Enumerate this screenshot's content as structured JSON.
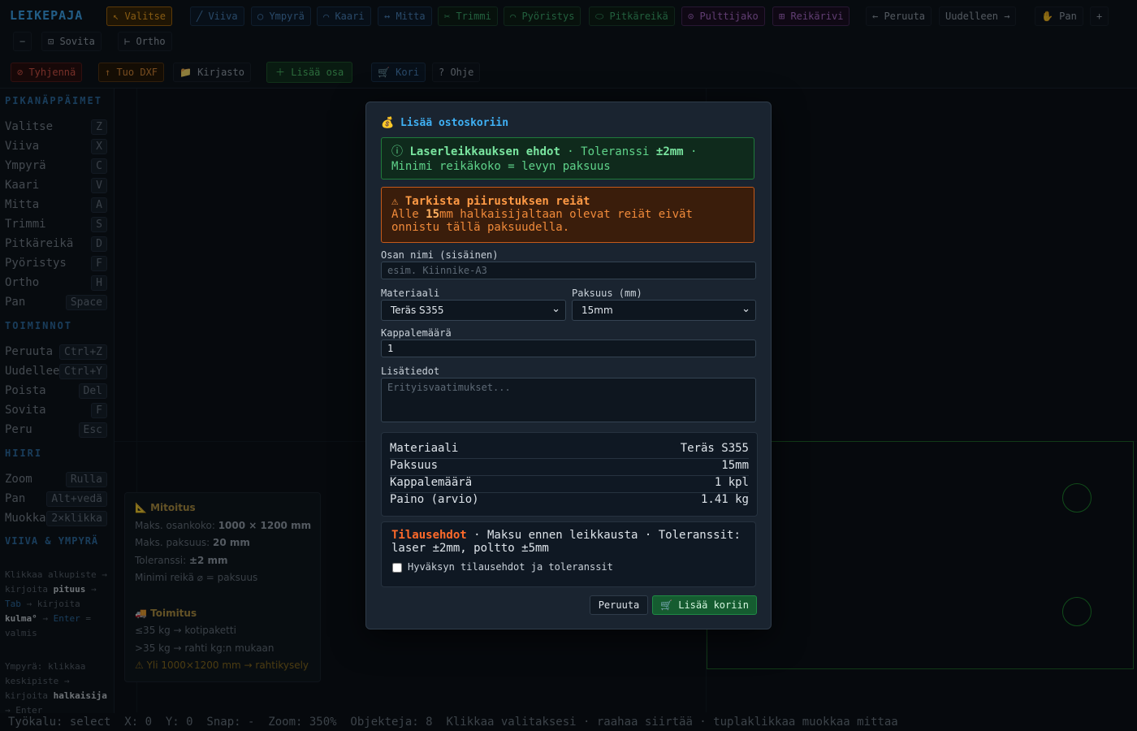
{
  "app": {
    "logo": "LEIKEPAJA"
  },
  "toolbar": {
    "tools": [
      {
        "label": "↖ Valitse"
      },
      {
        "label": "╱ Viiva"
      },
      {
        "label": "○ Ympyrä"
      },
      {
        "label": "⌒ Kaari"
      },
      {
        "label": "↔ Mitta"
      },
      {
        "label": "✂ Trimmi"
      },
      {
        "label": "⌒ Pyöristys"
      },
      {
        "label": "⬭ Pitkäreikä"
      },
      {
        "label": "⊙ Pulttijako"
      },
      {
        "label": "⊞ Reikärivi"
      }
    ],
    "undo": "← Peruuta",
    "redo": "Uudelleen →",
    "pan": "✋ Pan",
    "zoom_in": "+",
    "zoom_out": "−",
    "fit": "⊡ Sovita",
    "ortho": "⊢ Ortho",
    "clear": "⊘ Tyhjennä",
    "import": "↑ Tuo DXF",
    "library": "📁 Kirjasto",
    "add_part": "＋ Lisää osa",
    "cart": "🛒 Kori",
    "help": "? Ohje"
  },
  "sidebar": {
    "shortcuts_title": "PIKANÄPPÄIMET",
    "shortcuts": [
      {
        "name": "Valitse",
        "key": "Z"
      },
      {
        "name": "Viiva",
        "key": "X"
      },
      {
        "name": "Ympyrä",
        "key": "C"
      },
      {
        "name": "Kaari",
        "key": "V"
      },
      {
        "name": "Mitta",
        "key": "A"
      },
      {
        "name": "Trimmi",
        "key": "S"
      },
      {
        "name": "Pitkäreikä",
        "key": "D"
      },
      {
        "name": "Pyöristys",
        "key": "F"
      },
      {
        "name": "Ortho",
        "key": "H"
      },
      {
        "name": "Pan",
        "key": "Space"
      }
    ],
    "actions_title": "TOIMINNOT",
    "actions": [
      {
        "name": "Peruuta",
        "key": "Ctrl+Z"
      },
      {
        "name": "Uudelleen",
        "key": "Ctrl+Y"
      },
      {
        "name": "Poista",
        "key": "Del"
      },
      {
        "name": "Sovita",
        "key": "F"
      },
      {
        "name": "Peru",
        "key": "Esc"
      }
    ],
    "mouse_title": "HIIRI",
    "mouse": [
      {
        "name": "Zoom",
        "key": "Rulla"
      },
      {
        "name": "Pan",
        "key": "Alt+vedä"
      },
      {
        "name": "Muokkaa",
        "key": "2×klikka"
      }
    ],
    "line_title": "VIIVA & YMPYRÄ",
    "line_note": {
      "p1": "Klikkaa alkupiste → kirjoita ",
      "b1": "pituus",
      "p2": " → ",
      "tab": "Tab",
      "p3": " → kirjoita ",
      "b2": "kulma°",
      "p4": " → ",
      "enter": "Enter",
      "p5": " = valmis"
    },
    "circle_note": {
      "p1": "Ympyrä: klikkaa keskipiste → kirjoita ",
      "b1": "halkaisija",
      "p2": " → Enter"
    }
  },
  "info": {
    "dim_title": "📐 Mitoitus",
    "max_part_label": "Maks. osankoko: ",
    "max_part": "1000 × 1200 mm",
    "max_thick_label": "Maks. paksuus: ",
    "max_thick": "20 mm",
    "tol_label": "Toleranssi: ",
    "tol": "±2 mm",
    "min_hole": "Minimi reikä ⌀ = paksuus",
    "ship_title": "🚚 Toimitus",
    "ship1": "≤35 kg → kotipaketti",
    "ship2": ">35 kg → rahti kg:n mukaan",
    "ship3": "⚠ Yli 1000×1200 mm → rahtikysely"
  },
  "status": {
    "text": "Työkalu: select  X: 0  Y: 0  Snap: -  Zoom: 350%  Objekteja: 8  Klikkaa valitaksesi · raahaa siirtää · tuplaklikkaa muokkaa mittaa"
  },
  "modal": {
    "title": "💰 Lisää ostoskoriin",
    "info_icon": "ⓘ",
    "info_bold": "Laserleikkauksen ehdot",
    "info_text1": " · Toleranssi ",
    "info_tol": "±2mm",
    "info_text2": " · Minimi reikäkoko = levyn paksuus",
    "warn_title": "⚠ Tarkista piirustuksen reiät",
    "warn_p1": "Alle ",
    "warn_bold": "15",
    "warn_p2": "mm halkaisijaltaan olevat reiät eivät onnistu tällä paksuudella.",
    "name_label": "Osan nimi (sisäinen)",
    "name_placeholder": "esim. Kiinnike-A3",
    "material_label": "Materiaali",
    "material_value": "Teräs S355",
    "thickness_label": "Paksuus (mm)",
    "thickness_value": "15mm",
    "qty_label": "Kappalemäärä",
    "qty_value": "1",
    "notes_label": "Lisätiedot",
    "notes_placeholder": "Erityisvaatimukset...",
    "summary": [
      {
        "k": "Materiaali",
        "v": "Teräs S355"
      },
      {
        "k": "Paksuus",
        "v": "15mm"
      },
      {
        "k": "Kappalemäärä",
        "v": "1 kpl"
      },
      {
        "k": "Paino (arvio)",
        "v": "1.41 kg"
      }
    ],
    "terms_title": "Tilausehdot",
    "terms_text": " · Maksu ennen leikkausta · Toleranssit: laser ±2mm, poltto ±5mm",
    "accept_label": "Hyväksyn tilausehdot ja toleranssit",
    "cancel": "Peruuta",
    "add": "🛒 Lisää koriin"
  }
}
